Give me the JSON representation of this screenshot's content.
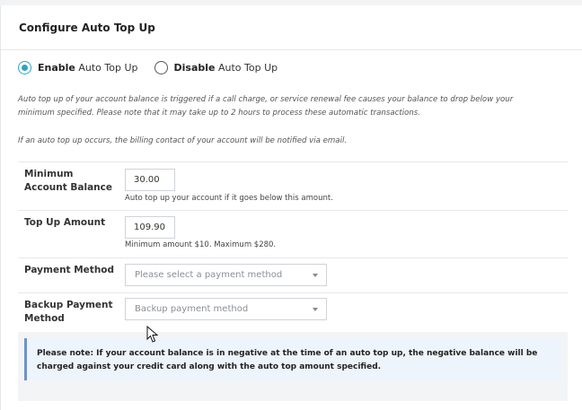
{
  "panel": {
    "title": "Configure Auto Top Up"
  },
  "mode": {
    "enable_bold": "Enable",
    "enable_rest": " Auto Top Up",
    "disable_bold": "Disable",
    "disable_rest": " Auto Top Up",
    "selected": "enable"
  },
  "notes": {
    "line1": "Auto top up of your account balance is triggered if a call charge, or service renewal fee causes your balance to drop below your minimum specified. Please note that it may take up to 2 hours to process these automatic transactions.",
    "line2": "If an auto top up occurs, the billing contact of your account will be notified via email."
  },
  "form": {
    "min_balance": {
      "label": "Minimum Account Balance",
      "value": "30.00",
      "help": "Auto top up your account if it goes below this amount."
    },
    "top_up": {
      "label": "Top Up Amount",
      "value": "109.90",
      "help": "Minimum amount $10. Maximum $280."
    },
    "payment": {
      "label": "Payment Method",
      "placeholder": "Please select a payment method"
    },
    "backup": {
      "label": "Backup Payment Method",
      "placeholder": "Backup payment method"
    }
  },
  "alert": {
    "text": "Please note: If your account balance is in negative at the time of an auto top up, the negative balance will be charged against your credit card along with the auto top amount specified."
  },
  "colors": {
    "accent": "#2aa4c4",
    "alert_border": "#6d93c9",
    "alert_bg": "#eef4fb"
  }
}
